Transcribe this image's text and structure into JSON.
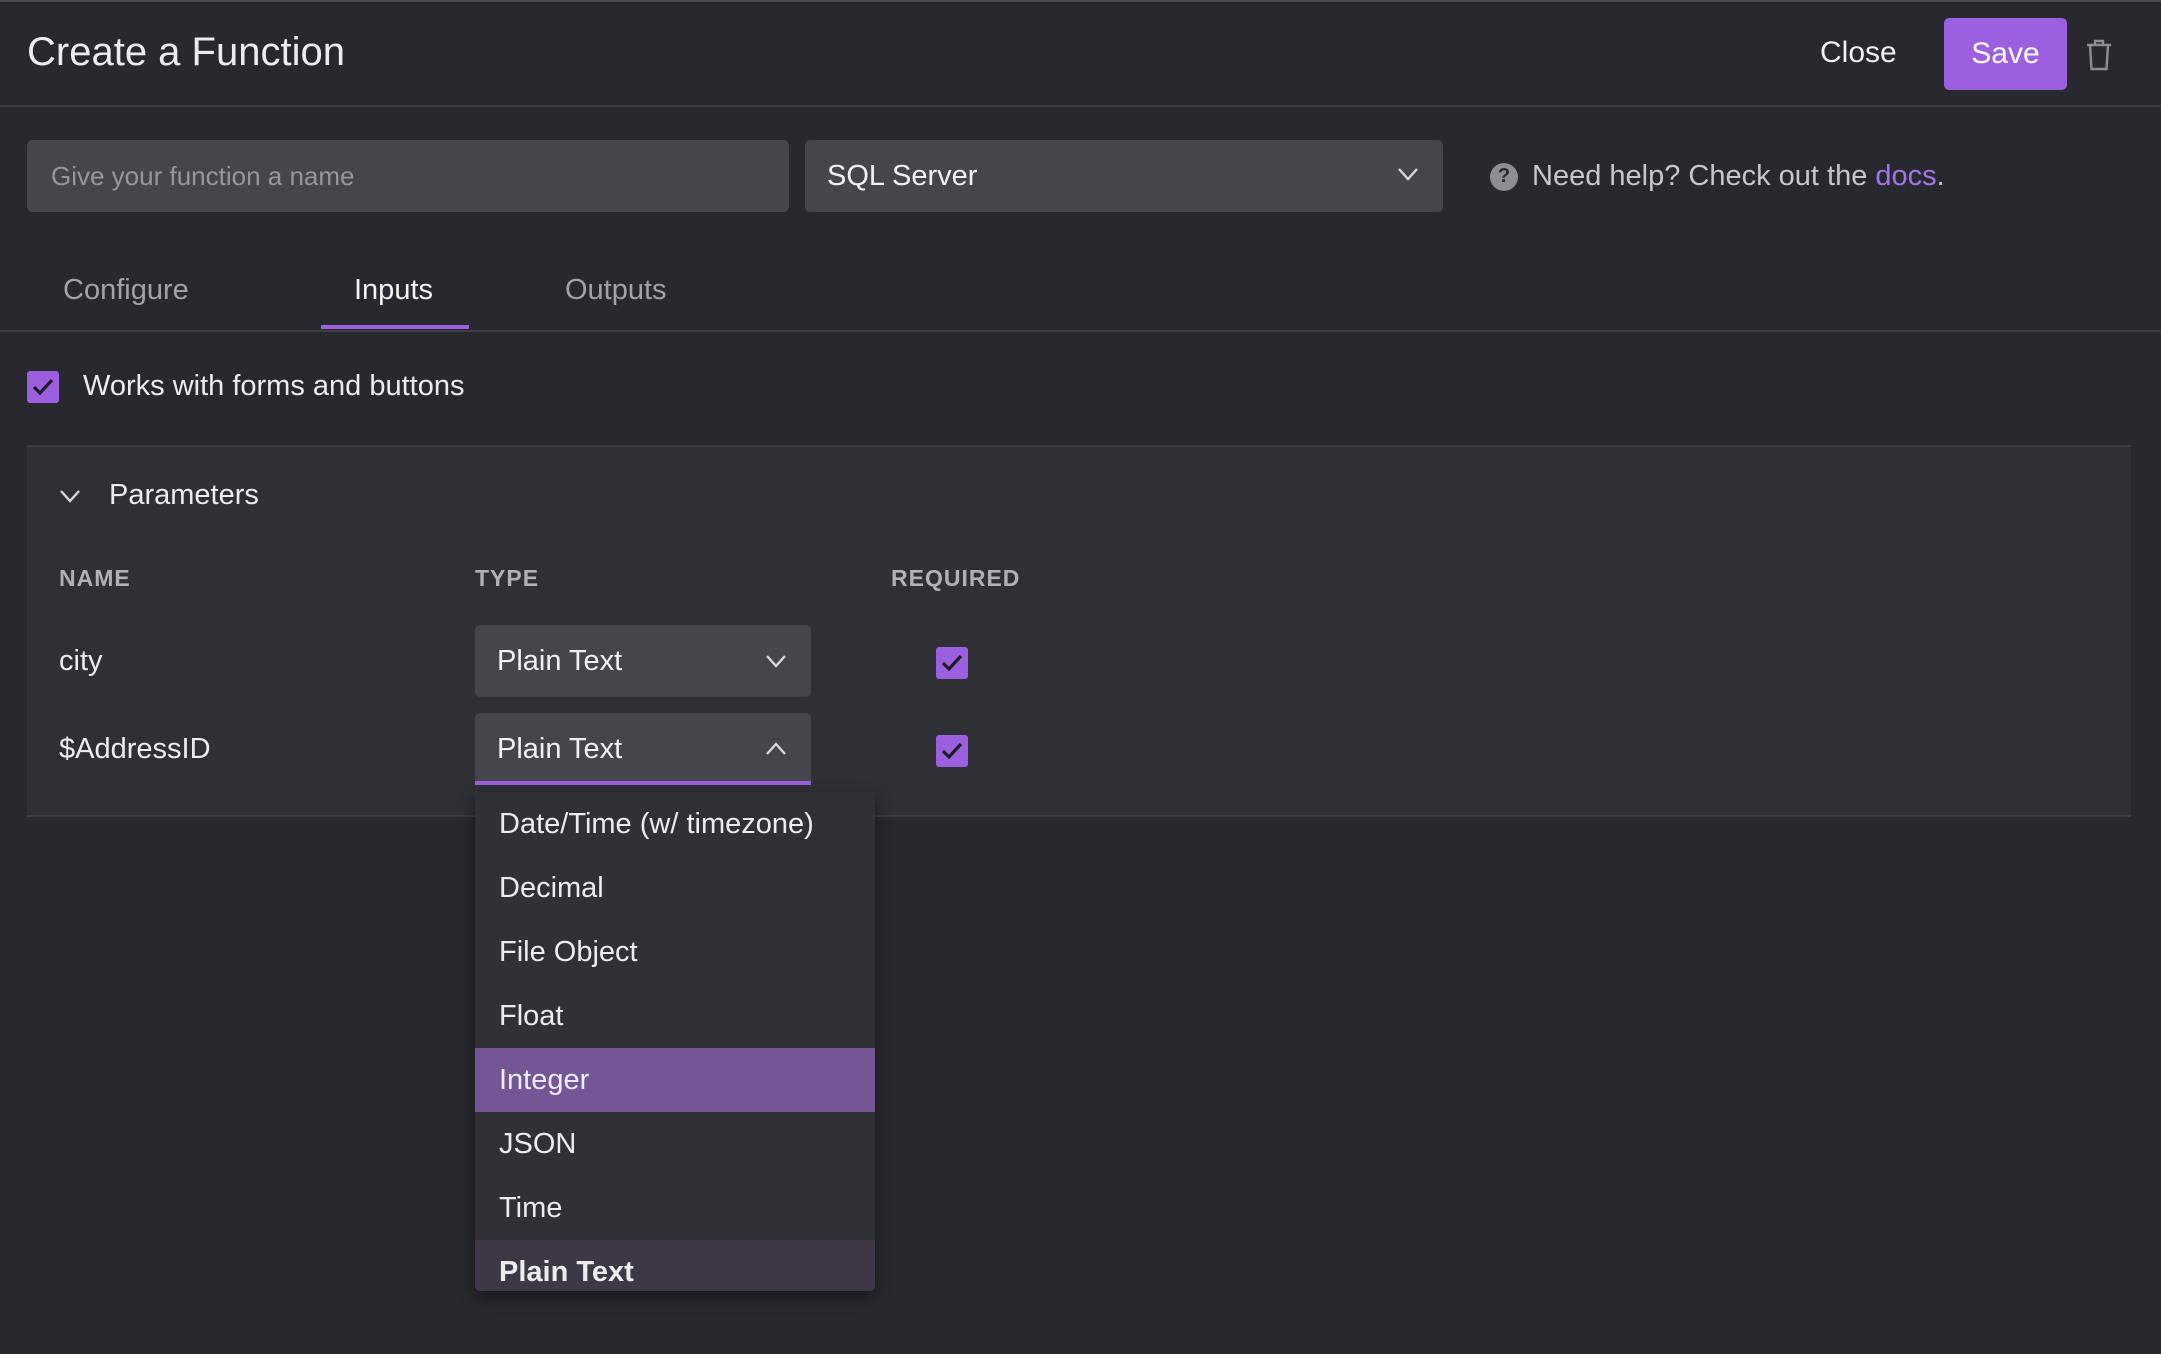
{
  "header": {
    "title": "Create a Function",
    "close_label": "Close",
    "save_label": "Save"
  },
  "name_input": {
    "placeholder": "Give your function a name",
    "value": ""
  },
  "database_select": {
    "value": "SQL Server"
  },
  "help": {
    "text": "Need help? Check out the ",
    "link": "docs",
    "suffix": "."
  },
  "tabs": [
    {
      "label": "Configure",
      "active": false
    },
    {
      "label": "Inputs",
      "active": true
    },
    {
      "label": "Outputs",
      "active": false
    }
  ],
  "forms_checkbox": {
    "label": "Works with forms and buttons",
    "checked": true
  },
  "parameters": {
    "title": "Parameters",
    "columns": {
      "name": "NAME",
      "type": "TYPE",
      "required": "REQUIRED"
    },
    "rows": [
      {
        "name": "city",
        "type": "Plain Text",
        "required": true,
        "open": false
      },
      {
        "name": "$AddressID",
        "type": "Plain Text",
        "required": true,
        "open": true
      }
    ]
  },
  "type_dropdown": {
    "options": [
      "Date/Time (w/ timezone)",
      "Decimal",
      "File Object",
      "Float",
      "Integer",
      "JSON",
      "Time",
      "Plain Text"
    ],
    "highlighted": "Integer",
    "selected": "Plain Text"
  },
  "colors": {
    "accent": "#9b5fe0",
    "background": "#28292e",
    "panel": "#2f3036",
    "field": "#45464c"
  }
}
